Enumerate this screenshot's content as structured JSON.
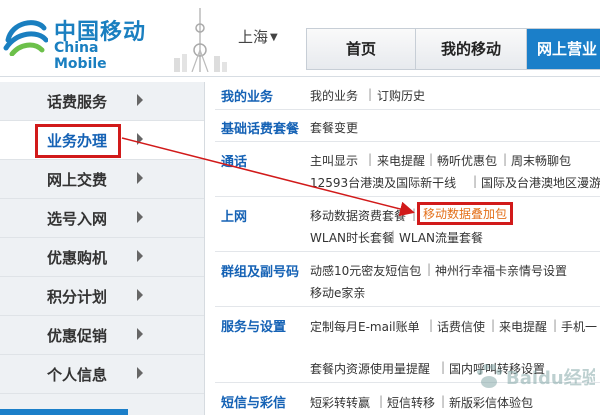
{
  "header": {
    "logo_cn": "中国移动",
    "logo_en": "China Mobile",
    "city": "上海",
    "tabs": [
      {
        "label": "首页"
      },
      {
        "label": "我的移动"
      },
      {
        "label": "网上营业"
      }
    ]
  },
  "leftmenu": {
    "items": [
      {
        "label": "话费服务"
      },
      {
        "label": "业务办理"
      },
      {
        "label": "网上交费"
      },
      {
        "label": "选号入网"
      },
      {
        "label": "优惠购机"
      },
      {
        "label": "积分计划"
      },
      {
        "label": "优惠促销"
      },
      {
        "label": "个人信息"
      }
    ],
    "active_index": 1
  },
  "content": {
    "rows": [
      {
        "category": "我的业务",
        "links": [
          "我的业务",
          "订购历史"
        ]
      },
      {
        "category": "基础话费套餐",
        "links": [
          "套餐变更"
        ]
      },
      {
        "category": "通话",
        "links": [
          "主叫显示",
          "来电提醒",
          "畅听优惠包",
          "周末畅聊包"
        ],
        "links2": [
          "12593台港澳及国际新干线",
          "国际及台港澳地区漫游"
        ]
      },
      {
        "category": "上网",
        "links": [
          "移动数据资费套餐",
          "移动数据叠加包"
        ],
        "links2": [
          "WLAN时长套餐",
          "WLAN流量套餐"
        ]
      },
      {
        "category": "群组及副号码",
        "links": [
          "动感10元密友短信包",
          "神州行幸福卡亲情号设置"
        ],
        "links2": [
          "移动e家亲"
        ]
      },
      {
        "category": "服务与设置",
        "links": [
          "定制每月E-mail账单",
          "话费信使",
          "来电提醒",
          "手机一"
        ],
        "links2": [
          "套餐内资源使用量提醒",
          "国内呼叫转移设置"
        ]
      },
      {
        "category": "短信与彩信",
        "links": [
          "短彩转转赢",
          "短信转移",
          "新版彩信体验包"
        ]
      }
    ]
  },
  "watermark": "Baidu经验",
  "colors": {
    "brand": "#1a7fc0",
    "highlight": "#d11a1a",
    "accent_link": "#e3701b"
  }
}
